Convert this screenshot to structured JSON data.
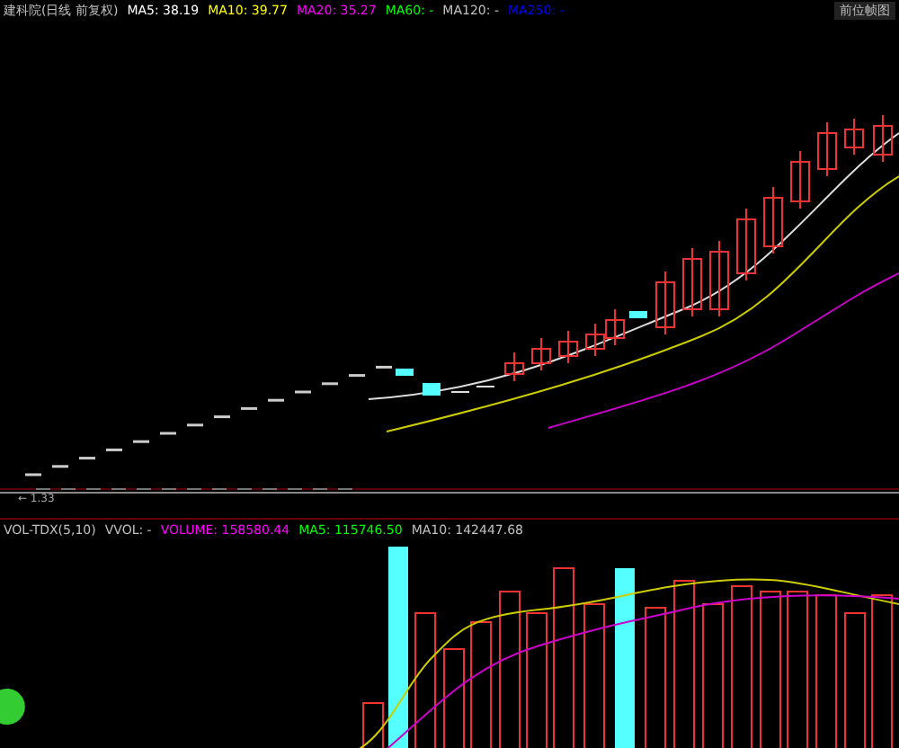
{
  "price_panel": {
    "title": "建科院(日线 前复权)",
    "indicators": [
      {
        "label": "MA5: 38.19",
        "color": "#ffffff"
      },
      {
        "label": "MA10: 39.77",
        "color": "#ffff00"
      },
      {
        "label": "MA20: 35.27",
        "color": "#ff00ff"
      },
      {
        "label": "MA60: -",
        "color": "#00ff00"
      },
      {
        "label": "MA120: -",
        "color": "#c0c0c0"
      },
      {
        "label": "MA250: -",
        "color": "#0000ff"
      }
    ],
    "button": "前位帧图",
    "low_label": "← 1.33"
  },
  "volume_panel": {
    "title": "VOL-TDX(5,10)",
    "indicators": [
      {
        "label": "VVOL: -",
        "color": "#c0c0c0"
      },
      {
        "label": "VOLUME: 158580.44",
        "color": "#ff00ff"
      },
      {
        "label": "MA5: 115746.50",
        "color": "#00ff00"
      },
      {
        "label": "MA10: 142447.68",
        "color": "#c0c0c0"
      }
    ]
  }
}
